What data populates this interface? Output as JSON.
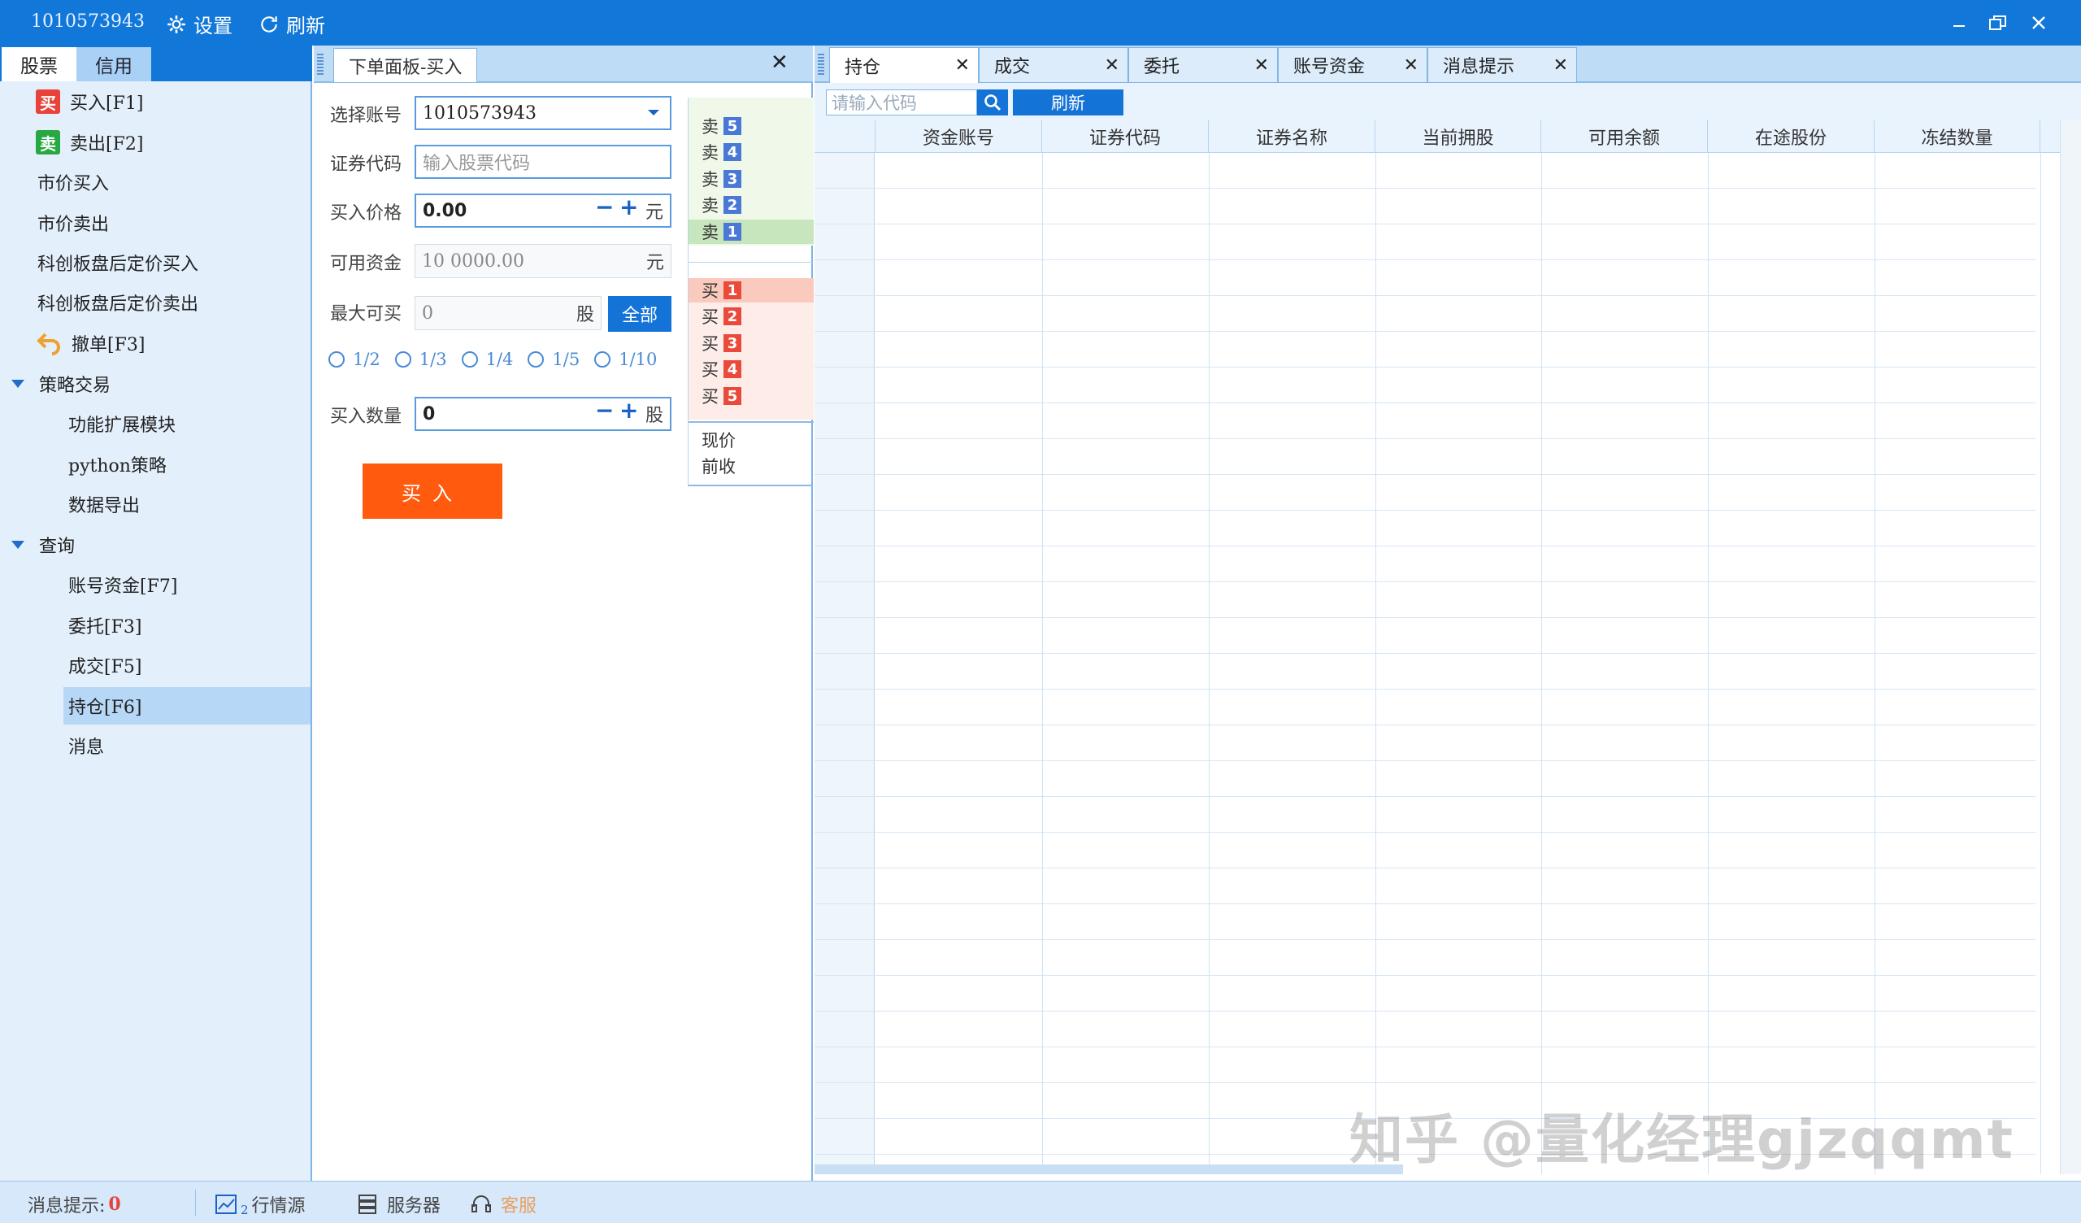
{
  "titlebar": {
    "account": "1010573943",
    "settings_label": "设置",
    "refresh_label": "刷新",
    "settings_icon": "gear-icon",
    "refresh_icon": "refresh-icon"
  },
  "left_tabs": [
    "股票",
    "信用"
  ],
  "sidebar": {
    "items": [
      {
        "label": "买入[F1]",
        "badge": "买",
        "badge_color": "#e8423a"
      },
      {
        "label": "卖出[F2]",
        "badge": "卖",
        "badge_color": "#27a844"
      },
      {
        "label": "市价买入"
      },
      {
        "label": "市价卖出"
      },
      {
        "label": "科创板盘后定价买入"
      },
      {
        "label": "科创板盘后定价卖出"
      },
      {
        "label": "撤单[F3]",
        "icon": "undo-icon"
      }
    ],
    "group1": {
      "label": "策略交易",
      "items": [
        "功能扩展模块",
        "python策略",
        "数据导出"
      ]
    },
    "group2": {
      "label": "查询",
      "items": [
        "账号资金[F7]",
        "委托[F3]",
        "成交[F5]",
        "持仓[F6]",
        "消息"
      ],
      "selected": "持仓[F6]"
    }
  },
  "order_panel": {
    "tab_title": "下单面板-买入",
    "account_label": "选择账号",
    "account_value": "1010573943",
    "code_label": "证券代码",
    "code_placeholder": "输入股票代码",
    "price_label": "买入价格",
    "price_value": "0.00",
    "price_unit": "元",
    "funds_label": "可用资金",
    "funds_value": "10 0000.00",
    "funds_unit": "元",
    "max_label": "最大可买",
    "max_value": "0",
    "max_unit": "股",
    "all_button": "全部",
    "fractions": [
      "1/2",
      "1/3",
      "1/4",
      "1/5",
      "1/10"
    ],
    "qty_label": "买入数量",
    "qty_value": "0",
    "qty_unit": "股",
    "buy_button": "买入"
  },
  "order_book": {
    "sell_label": "卖",
    "buy_label": "买",
    "sell_levels": [
      "5",
      "4",
      "3",
      "2",
      "1"
    ],
    "buy_levels": [
      "1",
      "2",
      "3",
      "4",
      "5"
    ],
    "current_label": "现价",
    "prev_close_label": "前收"
  },
  "right_tabs": [
    "持仓",
    "成交",
    "委托",
    "账号资金",
    "消息提示"
  ],
  "toolbar": {
    "search_placeholder": "请输入代码",
    "refresh_button": "刷新"
  },
  "table": {
    "columns": [
      "资金账号",
      "证券代码",
      "证券名称",
      "当前拥股",
      "可用余额",
      "在途股份",
      "冻结数量"
    ],
    "rows": []
  },
  "statusbar": {
    "msg_label": "消息提示:",
    "msg_count": "0",
    "market_label": "行情源",
    "market_sub": "2",
    "server_label": "服务器",
    "service_label": "客服"
  },
  "watermark": "知乎 @量化经理gjzqqmt",
  "colors": {
    "accent": "#1177d8",
    "buy_button": "#ff5a0e",
    "sidebar_bg": "#e3f0fc",
    "selected": "#b7d7f6"
  }
}
